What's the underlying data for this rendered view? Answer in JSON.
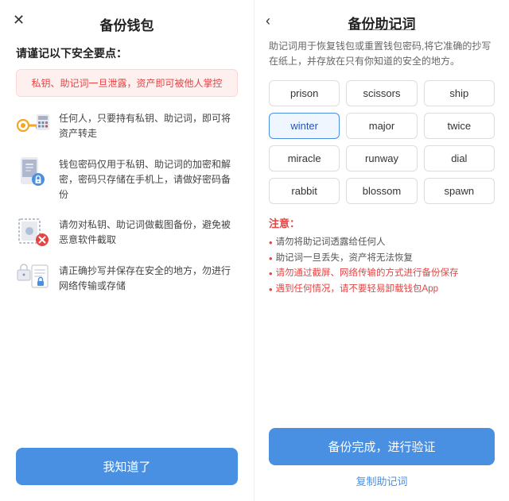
{
  "left": {
    "close_icon": "✕",
    "title": "备份钱包",
    "security_title": "请谨记以下安全要点：",
    "warning": "私钥、助记词一旦泄露，资产即可被他人掌控",
    "items": [
      {
        "id": "key-item",
        "text": "任何人，只要持有私钥、助记词，即可将资产转走"
      },
      {
        "id": "lock-item",
        "text": "钱包密码仅用于私钥、助记词的加密和解密，密码只存储在手机上，请做好密码备份"
      },
      {
        "id": "screenshot-item",
        "text": "请勿对私钥、助记词做截图备份，避免被恶意软件截取"
      },
      {
        "id": "safe-item",
        "text": "请正确抄写并保存在安全的地方，勿进行网络传输或存储"
      }
    ],
    "confirm_btn": "我知道了"
  },
  "right": {
    "back_icon": "‹",
    "title": "备份助记词",
    "description": "助记词用于恢复钱包或重置钱包密码,将它准确的抄写在纸上，并存放在只有你知道的安全的地方。",
    "words": [
      {
        "text": "prison",
        "highlighted": false
      },
      {
        "text": "scissors",
        "highlighted": false
      },
      {
        "text": "ship",
        "highlighted": false
      },
      {
        "text": "winter",
        "highlighted": true
      },
      {
        "text": "major",
        "highlighted": false
      },
      {
        "text": "twice",
        "highlighted": false
      },
      {
        "text": "miracle",
        "highlighted": false
      },
      {
        "text": "runway",
        "highlighted": false
      },
      {
        "text": "dial",
        "highlighted": false
      },
      {
        "text": "rabbit",
        "highlighted": false
      },
      {
        "text": "blossom",
        "highlighted": false
      },
      {
        "text": "spawn",
        "highlighted": false
      }
    ],
    "notice_title": "注意：",
    "notices": [
      {
        "text": "请勿将助记词透露给任何人",
        "red": false
      },
      {
        "text": "助记词一旦丢失，资产将无法恢复",
        "red": false
      },
      {
        "text": "请勿通过截屏、网络传输的方式进行备份保存",
        "red": true
      },
      {
        "text": "遇到任何情况，请不要轻易卸载钱包App",
        "red": true
      }
    ],
    "verify_btn": "备份完成，进行验证",
    "copy_link": "复制助记词"
  }
}
